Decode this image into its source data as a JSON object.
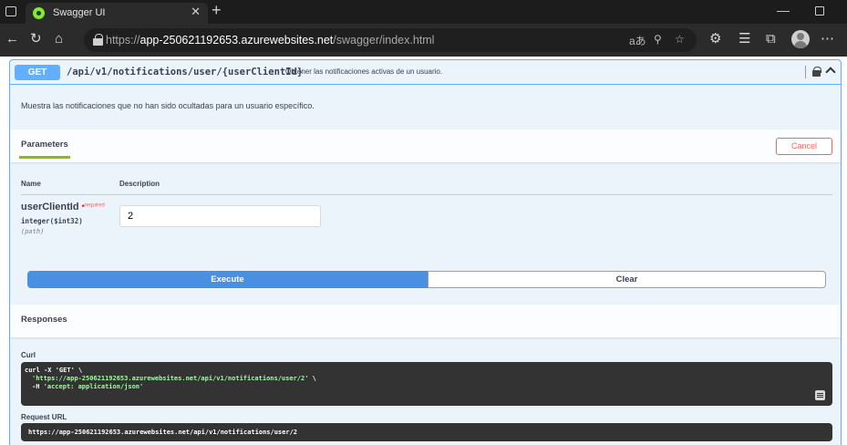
{
  "browser": {
    "tab_title": "Swagger UI",
    "tab_close": "✕",
    "new_tab": "+",
    "url_prefix": "https://",
    "url_host": "app-250621192653.azurewebsites.net",
    "url_path": "/swagger/index.html",
    "icons": [
      "back-icon",
      "refresh-icon",
      "home-icon",
      "lock-icon",
      "read-aloud-icon",
      "zoom-icon",
      "favorite-icon",
      "extensions-icon",
      "favorites-bar-icon",
      "collections-icon",
      "profile-avatar",
      "more-icon"
    ]
  },
  "operation": {
    "method": "GET",
    "path": "/api/v1/notifications/user/{userClientId}",
    "summary": "Obtener las notificaciones activas de un usuario.",
    "description": "Muestra las notificaciones que no han sido ocultadas para un usuario específico."
  },
  "parameters": {
    "tab_label": "Parameters",
    "cancel_label": "Cancel",
    "col_name": "Name",
    "col_description": "Description",
    "items": [
      {
        "name": "userClientId",
        "required_star": "*",
        "required_label": "required",
        "type": "integer($int32)",
        "in": "(path)",
        "value": "2"
      }
    ]
  },
  "actions": {
    "execute_label": "Execute",
    "clear_label": "Clear"
  },
  "responses": {
    "title": "Responses",
    "curl_label": "Curl",
    "curl_line1": "curl -X 'GET' \\",
    "curl_line2_url": "'https://app-250621192653.azurewebsites.net/api/v1/notifications/user/2'",
    "curl_line2_tail": " \\",
    "curl_line3_flag": "-H ",
    "curl_line3_header": "'accept: application/json'",
    "request_url_label": "Request URL",
    "request_url": "https://app-250621192653.azurewebsites.net/api/v1/notifications/user/2"
  },
  "colors": {
    "get_accent": "#61affe",
    "execute_blue": "#4990e2",
    "cancel_red": "#ff6060",
    "tab_underline": "#89bf04",
    "code_bg": "#333333"
  }
}
